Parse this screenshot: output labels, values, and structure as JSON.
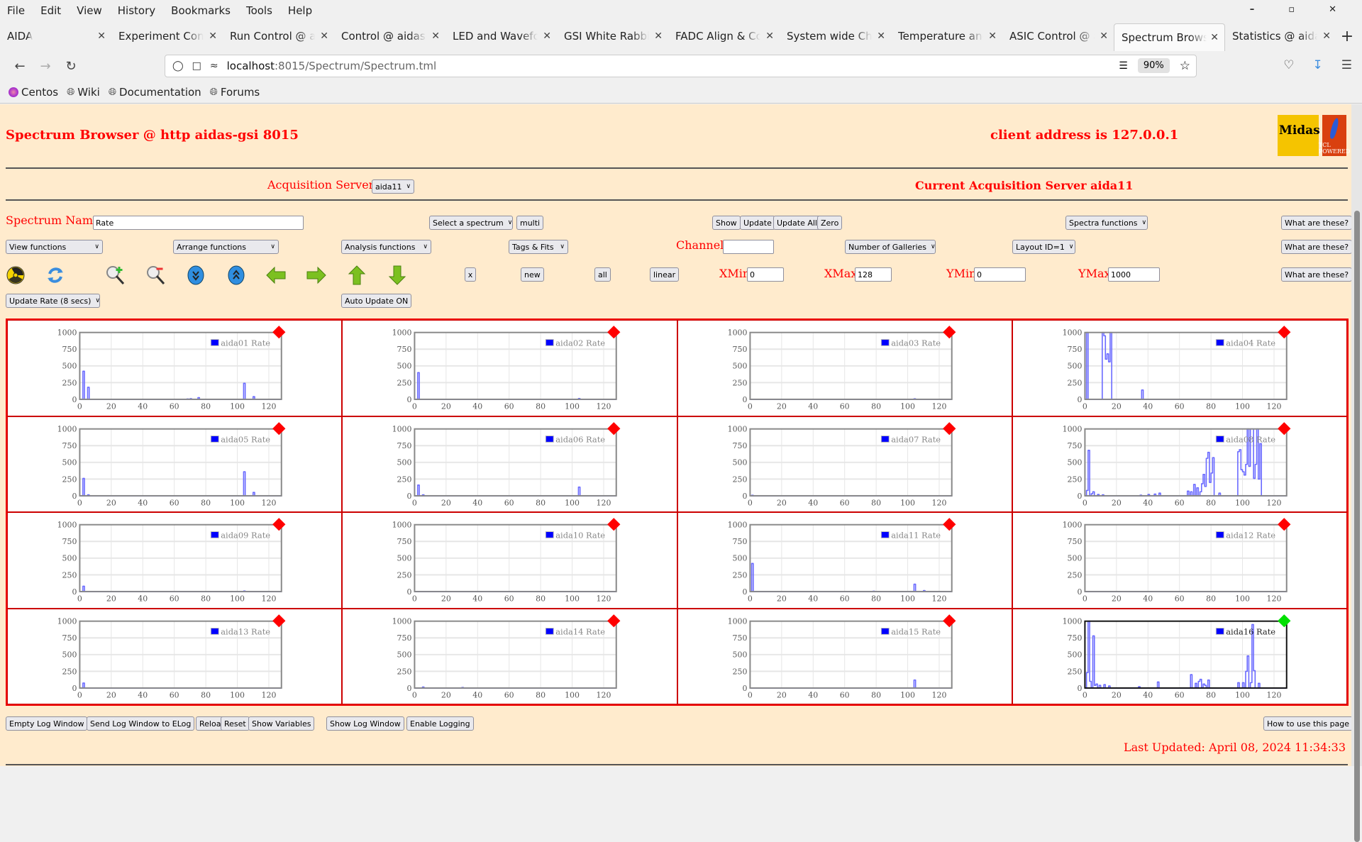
{
  "browser": {
    "menu": [
      "File",
      "Edit",
      "View",
      "History",
      "Bookmarks",
      "Tools",
      "Help"
    ],
    "tabs": [
      {
        "label": "AIDA",
        "active": false
      },
      {
        "label": "Experiment Control",
        "active": false
      },
      {
        "label": "Run Control @ aidas",
        "active": false
      },
      {
        "label": "Control @ aidas-gsi",
        "active": false
      },
      {
        "label": "LED and Waveform",
        "active": false
      },
      {
        "label": "GSI White Rabbit T",
        "active": false
      },
      {
        "label": "FADC Align & Cont",
        "active": false
      },
      {
        "label": "System wide Check",
        "active": false
      },
      {
        "label": "Temperature and s",
        "active": false
      },
      {
        "label": "ASIC Control @ aid",
        "active": false
      },
      {
        "label": "Spectrum Browser",
        "active": true
      },
      {
        "label": "Statistics @ aidas-",
        "active": false
      }
    ],
    "url_host": "localhost",
    "url_path": ":8015/Spectrum/Spectrum.tml",
    "zoom_level": "90%",
    "bookmarks": [
      "Centos",
      "Wiki",
      "Documentation",
      "Forums"
    ]
  },
  "page": {
    "title": "Spectrum Browser @ http aidas-gsi 8015",
    "client_address": "client address is 127.0.0.1",
    "logo_midas": "Midas",
    "logo_tcl": "TCL POWERED",
    "acq_servers_label": "Acquisition Servers",
    "acq_server_selected": "aida11",
    "current_server": "Current Acquisition Server aida11",
    "spectrum_name_label": "Spectrum Name:",
    "spectrum_name_value": "Rate",
    "select_spectrum": "Select a spectrum",
    "multi": "multi",
    "show": "Show",
    "update": "Update",
    "update_all": "Update All",
    "zero": "Zero",
    "spectra_functions": "Spectra functions",
    "what_are_these": "What are these?",
    "view_functions": "View functions",
    "arrange_functions": "Arrange functions",
    "analysis_functions": "Analysis functions",
    "tags_fits": "Tags & Fits",
    "channel_label": "Channel:",
    "channel_value": "",
    "num_galleries": "Number of Galleries",
    "layout_id": "Layout ID=1",
    "btn_x": "x",
    "btn_new": "new",
    "btn_all": "all",
    "btn_linear": "linear",
    "xmin_label": "XMin",
    "xmin_value": "0",
    "xmax_label": "XMax",
    "xmax_value": "128",
    "ymin_label": "YMin",
    "ymin_value": "0",
    "ymax_label": "YMax",
    "ymax_value": "1000",
    "update_rate": "Update Rate (8 secs)",
    "auto_update": "Auto Update ON",
    "bottom_buttons": [
      "Empty Log Window",
      "Send Log Window to ELog",
      "Reload",
      "Reset",
      "Show Variables",
      "Show Log Window",
      "Enable Logging"
    ],
    "how_to_use": "How to use this page",
    "last_updated": "Last Updated: April 08, 2024 11:34:33"
  },
  "toolbar_icons": [
    "radiation-icon",
    "refresh-icon",
    "zoom-in-icon",
    "zoom-out-icon",
    "expand-down-icon",
    "expand-up-icon",
    "arrow-left-icon",
    "arrow-right-icon",
    "arrow-up-icon",
    "arrow-down-icon"
  ],
  "colors": {
    "page_bg": "#ffebcd",
    "accent_red": "#ff0000",
    "series": "#0000ff",
    "status_red": "#ff0000",
    "status_green": "#00e000"
  },
  "chart_data": [
    {
      "type": "line",
      "title": "aida01 Rate",
      "legend": "aida01 Rate",
      "status": "red",
      "xlim": [
        0,
        128
      ],
      "ylim": [
        0,
        1000
      ],
      "xticks": [
        0,
        20,
        40,
        60,
        80,
        100,
        120
      ],
      "yticks": [
        0,
        250,
        500,
        750,
        1000
      ],
      "peaks": [
        [
          2,
          420
        ],
        [
          5,
          180
        ],
        [
          68,
          5
        ],
        [
          70,
          10
        ],
        [
          75,
          25
        ],
        [
          104,
          240
        ],
        [
          110,
          40
        ]
      ]
    },
    {
      "type": "line",
      "title": "aida02 Rate",
      "legend": "aida02 Rate",
      "status": "red",
      "xlim": [
        0,
        128
      ],
      "ylim": [
        0,
        1000
      ],
      "xticks": [
        0,
        20,
        40,
        60,
        80,
        100,
        120
      ],
      "yticks": [
        0,
        250,
        500,
        750,
        1000
      ],
      "peaks": [
        [
          2,
          400
        ],
        [
          104,
          12
        ]
      ]
    },
    {
      "type": "line",
      "title": "aida03 Rate",
      "legend": "aida03 Rate",
      "status": "red",
      "xlim": [
        0,
        128
      ],
      "ylim": [
        0,
        1000
      ],
      "xticks": [
        0,
        20,
        40,
        60,
        80,
        100,
        120
      ],
      "yticks": [
        0,
        250,
        500,
        750,
        1000
      ],
      "peaks": [
        [
          104,
          8
        ]
      ]
    },
    {
      "type": "line",
      "title": "aida04 Rate",
      "legend": "aida04 Rate",
      "status": "red",
      "xlim": [
        0,
        128
      ],
      "ylim": [
        0,
        1000
      ],
      "xticks": [
        0,
        20,
        40,
        60,
        80,
        100,
        120
      ],
      "yticks": [
        0,
        250,
        500,
        750,
        1000
      ],
      "peaks": [
        [
          1,
          1000
        ],
        [
          11,
          1000
        ],
        [
          12,
          950
        ],
        [
          13,
          600
        ],
        [
          14,
          680
        ],
        [
          15,
          560
        ],
        [
          16,
          1000
        ],
        [
          36,
          140
        ]
      ]
    },
    {
      "type": "line",
      "title": "aida05 Rate",
      "legend": "aida05 Rate",
      "status": "red",
      "xlim": [
        0,
        128
      ],
      "ylim": [
        0,
        1000
      ],
      "xticks": [
        0,
        20,
        40,
        60,
        80,
        100,
        120
      ],
      "yticks": [
        0,
        250,
        500,
        750,
        1000
      ],
      "peaks": [
        [
          2,
          260
        ],
        [
          5,
          15
        ],
        [
          104,
          360
        ],
        [
          110,
          50
        ]
      ]
    },
    {
      "type": "line",
      "title": "aida06 Rate",
      "legend": "aida06 Rate",
      "status": "red",
      "xlim": [
        0,
        128
      ],
      "ylim": [
        0,
        1000
      ],
      "xticks": [
        0,
        20,
        40,
        60,
        80,
        100,
        120
      ],
      "yticks": [
        0,
        250,
        500,
        750,
        1000
      ],
      "peaks": [
        [
          2,
          160
        ],
        [
          5,
          15
        ],
        [
          104,
          130
        ]
      ]
    },
    {
      "type": "line",
      "title": "aida07 Rate",
      "legend": "aida07 Rate",
      "status": "red",
      "xlim": [
        0,
        128
      ],
      "ylim": [
        0,
        1000
      ],
      "xticks": [
        0,
        20,
        40,
        60,
        80,
        100,
        120
      ],
      "yticks": [
        0,
        250,
        500,
        750,
        1000
      ],
      "peaks": [
        [
          1,
          8
        ]
      ]
    },
    {
      "type": "line",
      "title": "aida08 Rate",
      "legend": "aida08 Rate",
      "status": "red",
      "xlim": [
        0,
        128
      ],
      "ylim": [
        0,
        1000
      ],
      "xticks": [
        0,
        20,
        40,
        60,
        80,
        100,
        120
      ],
      "yticks": [
        0,
        250,
        500,
        750,
        1000
      ],
      "peaks": [
        [
          1,
          80
        ],
        [
          2,
          680
        ],
        [
          4,
          30
        ],
        [
          5,
          60
        ],
        [
          8,
          20
        ],
        [
          11,
          15
        ],
        [
          35,
          10
        ],
        [
          40,
          20
        ],
        [
          44,
          25
        ],
        [
          47,
          40
        ],
        [
          65,
          70
        ],
        [
          67,
          60
        ],
        [
          69,
          170
        ],
        [
          71,
          120
        ],
        [
          73,
          60
        ],
        [
          74,
          180
        ],
        [
          75,
          320
        ],
        [
          76,
          140
        ],
        [
          77,
          560
        ],
        [
          78,
          650
        ],
        [
          79,
          200
        ],
        [
          80,
          340
        ],
        [
          81,
          570
        ],
        [
          85,
          40
        ],
        [
          97,
          660
        ],
        [
          98,
          690
        ],
        [
          99,
          390
        ],
        [
          100,
          360
        ],
        [
          101,
          310
        ],
        [
          102,
          470
        ],
        [
          103,
          1000
        ],
        [
          104,
          440
        ],
        [
          105,
          1000
        ],
        [
          106,
          1000
        ],
        [
          107,
          260
        ],
        [
          108,
          470
        ],
        [
          109,
          1000
        ],
        [
          110,
          250
        ],
        [
          111,
          780
        ]
      ]
    },
    {
      "type": "line",
      "title": "aida09 Rate",
      "legend": "aida09 Rate",
      "status": "red",
      "xlim": [
        0,
        128
      ],
      "ylim": [
        0,
        1000
      ],
      "xticks": [
        0,
        20,
        40,
        60,
        80,
        100,
        120
      ],
      "yticks": [
        0,
        250,
        500,
        750,
        1000
      ],
      "peaks": [
        [
          2,
          80
        ],
        [
          104,
          8
        ]
      ]
    },
    {
      "type": "line",
      "title": "aida10 Rate",
      "legend": "aida10 Rate",
      "status": "red",
      "xlim": [
        0,
        128
      ],
      "ylim": [
        0,
        1000
      ],
      "xticks": [
        0,
        20,
        40,
        60,
        80,
        100,
        120
      ],
      "yticks": [
        0,
        250,
        500,
        750,
        1000
      ],
      "peaks": []
    },
    {
      "type": "line",
      "title": "aida11 Rate",
      "legend": "aida11 Rate",
      "status": "red",
      "xlim": [
        0,
        128
      ],
      "ylim": [
        0,
        1000
      ],
      "xticks": [
        0,
        20,
        40,
        60,
        80,
        100,
        120
      ],
      "yticks": [
        0,
        250,
        500,
        750,
        1000
      ],
      "peaks": [
        [
          1,
          420
        ],
        [
          78,
          5
        ],
        [
          104,
          110
        ],
        [
          110,
          15
        ]
      ]
    },
    {
      "type": "line",
      "title": "aida12 Rate",
      "legend": "aida12 Rate",
      "status": "red",
      "xlim": [
        0,
        128
      ],
      "ylim": [
        0,
        1000
      ],
      "xticks": [
        0,
        20,
        40,
        60,
        80,
        100,
        120
      ],
      "yticks": [
        0,
        250,
        500,
        750,
        1000
      ],
      "peaks": []
    },
    {
      "type": "line",
      "title": "aida13 Rate",
      "legend": "aida13 Rate",
      "status": "red",
      "xlim": [
        0,
        128
      ],
      "ylim": [
        0,
        1000
      ],
      "xticks": [
        0,
        20,
        40,
        60,
        80,
        100,
        120
      ],
      "yticks": [
        0,
        250,
        500,
        750,
        1000
      ],
      "peaks": [
        [
          2,
          75
        ]
      ]
    },
    {
      "type": "line",
      "title": "aida14 Rate",
      "legend": "aida14 Rate",
      "status": "red",
      "xlim": [
        0,
        128
      ],
      "ylim": [
        0,
        1000
      ],
      "xticks": [
        0,
        20,
        40,
        60,
        80,
        100,
        120
      ],
      "yticks": [
        0,
        250,
        500,
        750,
        1000
      ],
      "peaks": [
        [
          5,
          15
        ],
        [
          30,
          8
        ]
      ]
    },
    {
      "type": "line",
      "title": "aida15 Rate",
      "legend": "aida15 Rate",
      "status": "red",
      "xlim": [
        0,
        128
      ],
      "ylim": [
        0,
        1000
      ],
      "xticks": [
        0,
        20,
        40,
        60,
        80,
        100,
        120
      ],
      "yticks": [
        0,
        250,
        500,
        750,
        1000
      ],
      "peaks": [
        [
          104,
          120
        ]
      ]
    },
    {
      "type": "line",
      "title": "aida16 Rate",
      "legend": "aida16 Rate",
      "status": "green",
      "selected": true,
      "xlim": [
        0,
        128
      ],
      "ylim": [
        0,
        1000
      ],
      "xticks": [
        0,
        20,
        40,
        60,
        80,
        100,
        120
      ],
      "yticks": [
        0,
        250,
        500,
        750,
        1000
      ],
      "peaks": [
        [
          1,
          230
        ],
        [
          2,
          1000
        ],
        [
          3,
          100
        ],
        [
          5,
          780
        ],
        [
          6,
          40
        ],
        [
          7,
          60
        ],
        [
          9,
          40
        ],
        [
          12,
          50
        ],
        [
          15,
          30
        ],
        [
          34,
          20
        ],
        [
          46,
          90
        ],
        [
          67,
          200
        ],
        [
          70,
          70
        ],
        [
          72,
          100
        ],
        [
          73,
          130
        ],
        [
          75,
          60
        ],
        [
          76,
          40
        ],
        [
          78,
          120
        ],
        [
          97,
          80
        ],
        [
          100,
          80
        ],
        [
          102,
          250
        ],
        [
          103,
          480
        ],
        [
          105,
          80
        ],
        [
          106,
          950
        ],
        [
          107,
          260
        ],
        [
          110,
          70
        ]
      ]
    }
  ]
}
